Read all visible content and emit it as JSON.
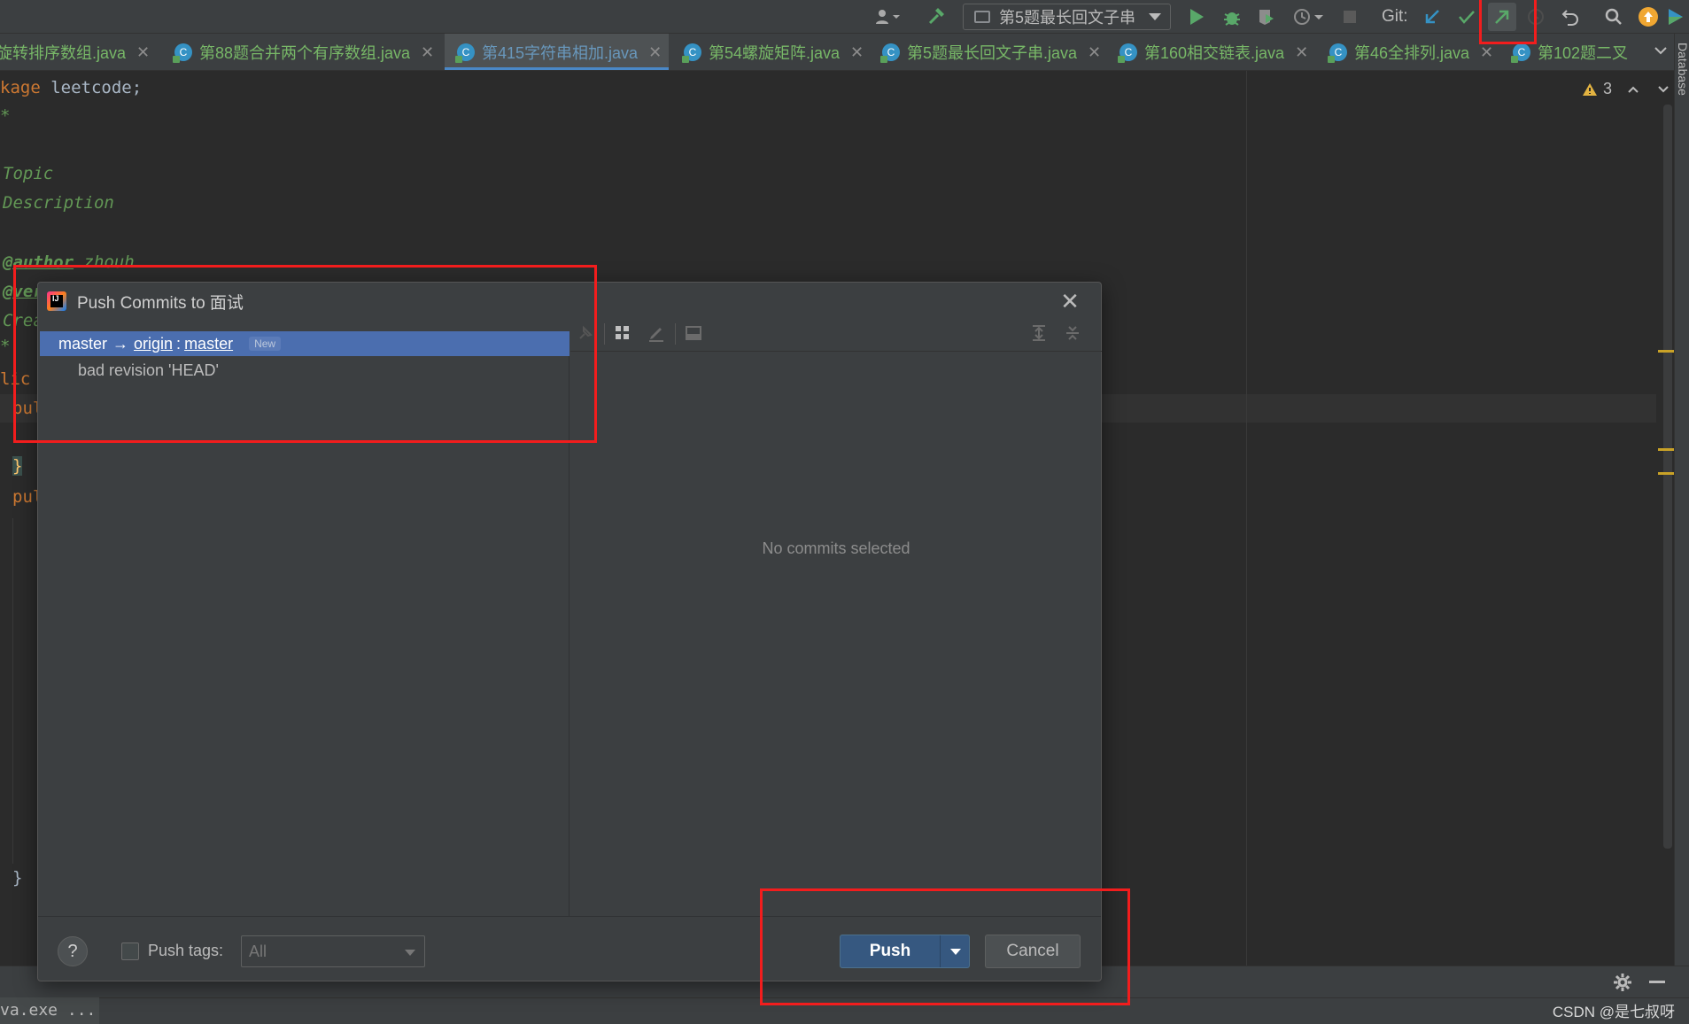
{
  "toolbar": {
    "run_config": "第5题最长回文子串",
    "git_label": "Git:"
  },
  "tabs": [
    {
      "label": "旋转排序数组.java"
    },
    {
      "label": "第88题合并两个有序数组.java"
    },
    {
      "label": "第415字符串相加.java",
      "active": true
    },
    {
      "label": "第54螺旋矩阵.java"
    },
    {
      "label": "第5题最长回文子串.java"
    },
    {
      "label": "第160相交链表.java"
    },
    {
      "label": "第46全排列.java"
    },
    {
      "label": "第102题二叉"
    }
  ],
  "editor": {
    "line1_kw": "kage",
    "line1_rest": " leetcode;",
    "line2": "*",
    "topic": "Topic",
    "description": "Description",
    "author_tag": "@author",
    "author_name": " zhouh",
    "version_tag": "@ver",
    "created": "Crea",
    "star": "*",
    "public1": "lic",
    "pub1": "pul",
    "brace1": "}",
    "pub2": "pul",
    "brace2": "}",
    "warnings_count": "3"
  },
  "dialog": {
    "title": "Push Commits to 面试",
    "branch_local": "master",
    "arrow": "→",
    "remote": "origin",
    "separator": ":",
    "branch_remote": "master",
    "new_badge": "New",
    "commit_message": "bad revision 'HEAD'",
    "no_commits": "No commits selected",
    "push_tags_label": "Push tags:",
    "tags_select_value": "All",
    "push_button": "Push",
    "cancel_button": "Cancel",
    "help": "?"
  },
  "status": {
    "left": "va.exe ...",
    "watermark": "CSDN @是七叔呀"
  },
  "right_strip": {
    "label": "Database"
  }
}
